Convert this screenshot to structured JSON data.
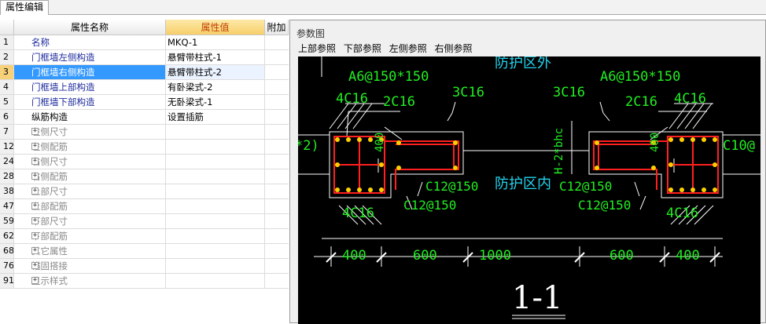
{
  "tab": {
    "label": "属性编辑"
  },
  "grid": {
    "headers": {
      "name": "属性名称",
      "value": "属性值",
      "add": "附加"
    },
    "rows": [
      {
        "num": "1",
        "name": "名称",
        "value": "MKQ-1"
      },
      {
        "num": "2",
        "name": "门框墙左侧构造",
        "value": "悬臂带柱式-1"
      },
      {
        "num": "3",
        "name": "门框墙右侧构造",
        "value": "悬臂带柱式-2"
      },
      {
        "num": "4",
        "name": "门框墙上部构造",
        "value": "有卧梁式-2"
      },
      {
        "num": "5",
        "name": "门框墙下部构造",
        "value": "无卧梁式-1"
      },
      {
        "num": "6",
        "name": "纵筋构造",
        "value": "设置插筋"
      },
      {
        "num": "7",
        "name": "左侧尺寸",
        "value": ""
      },
      {
        "num": "12",
        "name": "左侧配筋",
        "value": ""
      },
      {
        "num": "24",
        "name": "右侧尺寸",
        "value": ""
      },
      {
        "num": "28",
        "name": "右侧配筋",
        "value": ""
      },
      {
        "num": "38",
        "name": "上部尺寸",
        "value": ""
      },
      {
        "num": "47",
        "name": "上部配筋",
        "value": ""
      },
      {
        "num": "59",
        "name": "下部尺寸",
        "value": ""
      },
      {
        "num": "62",
        "name": "下部配筋",
        "value": ""
      },
      {
        "num": "68",
        "name": "其它属性",
        "value": ""
      },
      {
        "num": "76",
        "name": "锚固搭接",
        "value": ""
      },
      {
        "num": "91",
        "name": "显示样式",
        "value": ""
      }
    ]
  },
  "panel": {
    "title": "参数图",
    "tabs": [
      "上部参照",
      "下部参照",
      "左侧参照",
      "右侧参照"
    ]
  },
  "drawing": {
    "top_label": "防护区外",
    "inner_label": "防护区内",
    "left_stirrup": "A6@150*150",
    "right_stirrup": "A6@150*150",
    "left_4c16_top": "4C16",
    "left_2c16": "2C16",
    "left_3c16": "3C16",
    "right_3c16": "3C16",
    "right_2c16": "2C16",
    "right_4c16_top": "4C16",
    "left_400": "400",
    "right_400": "400",
    "h_label": "H-2*bhc",
    "left_edge": "*2)",
    "right_edge": "C10@",
    "c12_a": "C12@150",
    "c12_b": "C12@150",
    "c12_c": "C12@150",
    "c12_d": "C12@150",
    "left_4c16_bot": "4C16",
    "right_4c16_bot": "4C16",
    "dims": [
      "400",
      "600",
      "1000",
      "600",
      "400"
    ],
    "section": "1-1"
  }
}
